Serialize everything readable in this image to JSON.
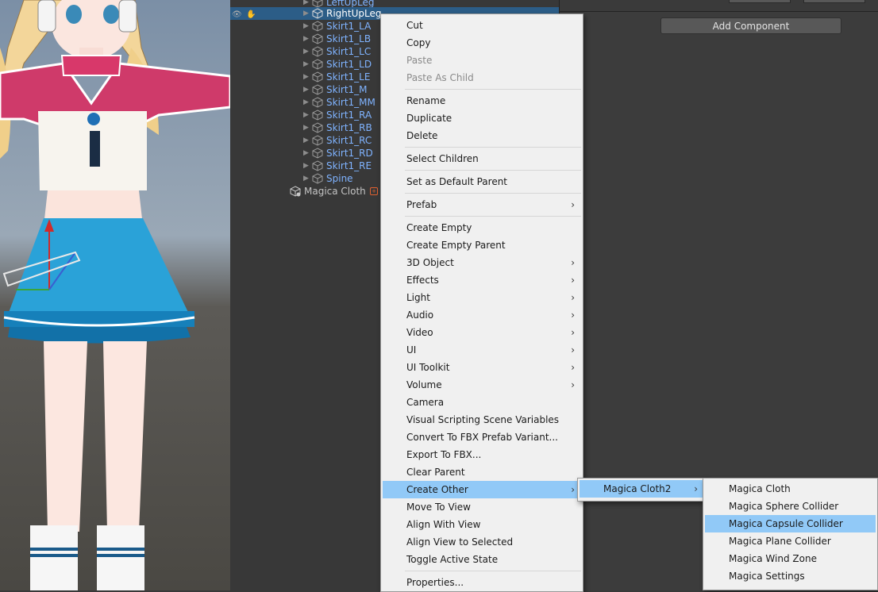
{
  "hierarchy": {
    "top_partial": "LeftUpLeg",
    "selected": "RightUpLeg",
    "children": [
      "Skirt1_LA",
      "Skirt1_LB",
      "Skirt1_LC",
      "Skirt1_LD",
      "Skirt1_LE",
      "Skirt1_M",
      "Skirt1_MM",
      "Skirt1_RA",
      "Skirt1_RB",
      "Skirt1_RC",
      "Skirt1_RD",
      "Skirt1_RE",
      "Spine"
    ],
    "root": "Magica Cloth"
  },
  "inspector": {
    "add_component": "Add Component"
  },
  "context_menu": {
    "items": [
      {
        "label": "Cut"
      },
      {
        "label": "Copy"
      },
      {
        "label": "Paste",
        "disabled": true
      },
      {
        "label": "Paste As Child",
        "disabled": true
      },
      {
        "sep": true
      },
      {
        "label": "Rename"
      },
      {
        "label": "Duplicate"
      },
      {
        "label": "Delete"
      },
      {
        "sep": true
      },
      {
        "label": "Select Children"
      },
      {
        "sep": true
      },
      {
        "label": "Set as Default Parent"
      },
      {
        "sep": true
      },
      {
        "label": "Prefab",
        "submenu": true
      },
      {
        "sep": true
      },
      {
        "label": "Create Empty"
      },
      {
        "label": "Create Empty Parent"
      },
      {
        "label": "3D Object",
        "submenu": true
      },
      {
        "label": "Effects",
        "submenu": true
      },
      {
        "label": "Light",
        "submenu": true
      },
      {
        "label": "Audio",
        "submenu": true
      },
      {
        "label": "Video",
        "submenu": true
      },
      {
        "label": "UI",
        "submenu": true
      },
      {
        "label": "UI Toolkit",
        "submenu": true
      },
      {
        "label": "Volume",
        "submenu": true
      },
      {
        "label": "Camera"
      },
      {
        "label": "Visual Scripting Scene Variables"
      },
      {
        "label": "Convert To FBX Prefab Variant..."
      },
      {
        "label": "Export To FBX..."
      },
      {
        "label": "Clear Parent"
      },
      {
        "label": "Create Other",
        "submenu": true,
        "highlighted": true
      },
      {
        "label": "Move To View"
      },
      {
        "label": "Align With View"
      },
      {
        "label": "Align View to Selected"
      },
      {
        "label": "Toggle Active State"
      },
      {
        "sep": true
      },
      {
        "label": "Properties..."
      }
    ]
  },
  "submenu_create_other": {
    "items": [
      {
        "label": "Magica Cloth2",
        "submenu": true,
        "highlighted": true
      }
    ]
  },
  "submenu_magica": {
    "items": [
      {
        "label": "Magica Cloth"
      },
      {
        "label": "Magica Sphere Collider"
      },
      {
        "label": "Magica Capsule Collider",
        "highlighted": true
      },
      {
        "label": "Magica Plane Collider"
      },
      {
        "label": "Magica Wind Zone"
      },
      {
        "label": "Magica Settings"
      }
    ]
  },
  "icons": {
    "visibility": "eye-icon",
    "pickable": "hand-icon",
    "gameobject": "cube-icon",
    "expand": "triangle-right-icon",
    "submenu": "chevron-right-icon"
  }
}
